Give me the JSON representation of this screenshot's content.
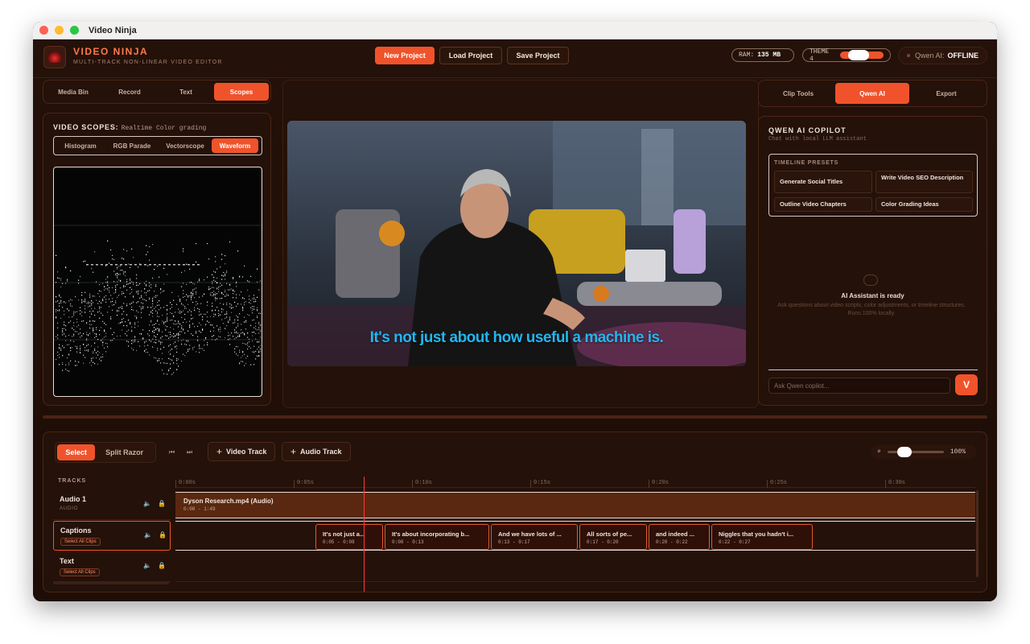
{
  "window": {
    "title": "Video Ninja"
  },
  "header": {
    "brand": "VIDEO NINJA",
    "subtitle": "MULTI-TRACK NON-LINEAR VIDEO EDITOR",
    "new_project": "New Project",
    "load_project": "Load Project",
    "save_project": "Save Project",
    "ram_label": "RAM:",
    "ram_value": "135 MB",
    "theme_label": "THEME 4",
    "qwen_label": "Qwen AI:",
    "qwen_status": "OFFLINE"
  },
  "left_tabs": [
    "Media Bin",
    "Record",
    "Text",
    "Scopes"
  ],
  "scopes": {
    "title": "VIDEO SCOPES:",
    "subtitle": "Realtime Color grading",
    "tabs": [
      "Histogram",
      "RGB Parade",
      "Vectorscope",
      "Waveform"
    ]
  },
  "preview": {
    "caption": "It's not just about how useful a machine is."
  },
  "right_tabs": [
    "Clip Tools",
    "Qwen AI",
    "Export"
  ],
  "ai": {
    "title": "QWEN AI COPILOT",
    "subtitle": "Chat with local LLM assistant",
    "presets_label": "TIMELINE PRESETS",
    "presets": [
      "Generate Social Titles",
      "Write Video SEO Description",
      "Outline Video Chapters",
      "Color Grading Ideas"
    ],
    "ready_title": "AI Assistant is ready",
    "ready_desc": "Ask questions about video scripts, color adjustments, or timeline structures. Runs 100% locally.",
    "input_placeholder": "Ask Qwen copilot...",
    "send_label": "V"
  },
  "timeline": {
    "tool_select": "Select",
    "tool_razor": "Split Razor",
    "add_video": "Video Track",
    "add_audio": "Audio Track",
    "zoom_value": "100%",
    "tracks_label": "TRACKS",
    "ticks": [
      "0:00s",
      "0:05s",
      "0:10s",
      "0:15s",
      "0:20s",
      "0:25s",
      "0:30s"
    ],
    "tracks": [
      {
        "name": "Audio 1",
        "sub": "AUDIO"
      },
      {
        "name": "Captions",
        "sub": "Select All Clips"
      },
      {
        "name": "Text",
        "sub": "Select All Clips"
      }
    ],
    "audio_clip": {
      "label": "Dyson Research.mp4 (Audio)",
      "time": "0:00 - 1:49"
    },
    "caption_clips": [
      {
        "label": "It's not just a...",
        "time": "0:05 - 0:08"
      },
      {
        "label": "It's about incorporating b...",
        "time": "0:08 - 0:13"
      },
      {
        "label": "And we have lots of ...",
        "time": "0:13 - 0:17"
      },
      {
        "label": "All sorts of pe...",
        "time": "0:17 - 0:20"
      },
      {
        "label": "and indeed ...",
        "time": "0:20 - 0:22"
      },
      {
        "label": "Niggles that you hadn't i...",
        "time": "0:22 - 0:27"
      }
    ]
  },
  "colors": {
    "accent": "#f0532b",
    "background": "#1f0f07",
    "caption": "#22b6f0"
  }
}
